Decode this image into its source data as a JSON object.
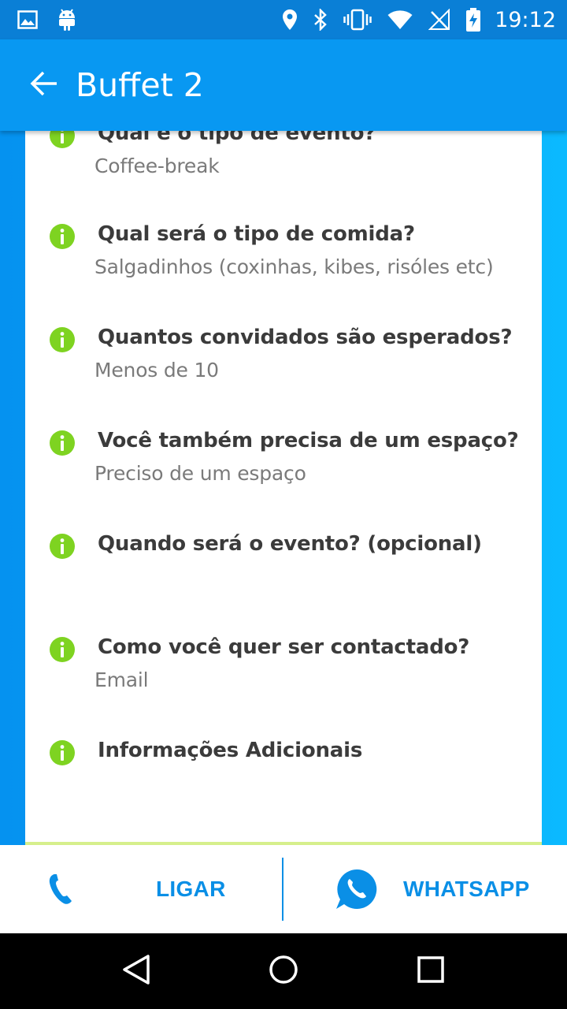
{
  "status_bar": {
    "time": "19:12",
    "icons": [
      "image-icon",
      "android-icon",
      "location-icon",
      "bluetooth-icon",
      "vibrate-icon",
      "wifi-icon",
      "no-signal-icon",
      "battery-charging-icon"
    ]
  },
  "app_bar": {
    "title": "Buffet 2",
    "back_icon": "arrow-left-icon"
  },
  "fields": [
    {
      "question": "Qual é o tipo de evento?",
      "answer": "Coffee-break"
    },
    {
      "question": "Qual será o tipo de comida?",
      "answer": "Salgadinhos (coxinhas, kibes, risóles etc)"
    },
    {
      "question": "Quantos convidados são esperados?",
      "answer": "Menos de 10"
    },
    {
      "question": "Você também precisa de um espaço?",
      "answer": "Preciso de um espaço"
    },
    {
      "question": "Quando será o evento? (opcional)",
      "answer": ""
    },
    {
      "question": "Como você quer ser contactado?",
      "answer": "Email"
    },
    {
      "question": "Informações Adicionais",
      "answer": ""
    }
  ],
  "actions": {
    "call_label": "LIGAR",
    "whatsapp_label": "WHATSAPP"
  },
  "colors": {
    "primary": "#0898f2",
    "status_bar": "#0a7fd6",
    "info_icon": "#7ed321",
    "action_text": "#0a8fe6"
  }
}
